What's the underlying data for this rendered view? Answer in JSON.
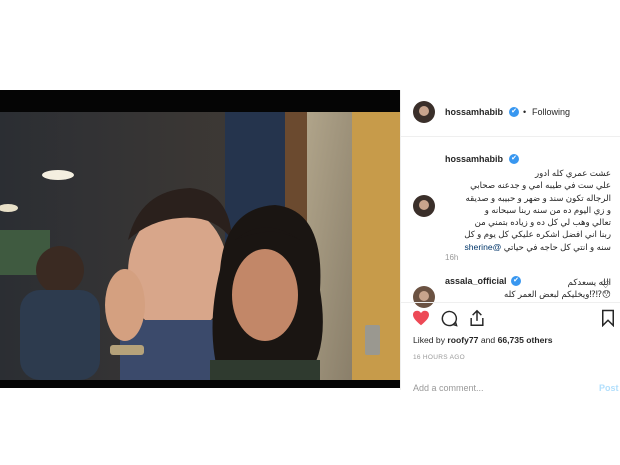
{
  "post": {
    "username": "hossamhabib",
    "verified_mark": "✔",
    "separator": "•",
    "follow_status": "Following",
    "caption_user": "hossamhabib",
    "caption_lines": [
      "عشت عمري كله ادور",
      "علي ست في طيبه امي و جدعنه صحابي",
      "الرجاله تكون سند و ضهر و حبيبه و صديقه",
      "و زي اليوم ده من سنه ربنا سبحانه و",
      "تعالي وهب لي كل ده و زياده بتمني من",
      "ربنا اني افضل اشكره عليكي كل يوم و كل"
    ],
    "caption_last": "سنه و انتي كل حاجه في حياتي",
    "mention": "@sherine",
    "caption_age": "16h",
    "comment_user": "assala_official",
    "comment_line1": "الله يسعدكم",
    "comment_line2": "😯⁉⁉ويخليكم لبعض العمر كله",
    "likes_prefix": "Liked by",
    "likes_user": "roofy77",
    "likes_and": "and",
    "likes_count": "66,735 others",
    "time_ago": "16 HOURS AGO",
    "add_comment": "Add a comment...",
    "post_button": "Post"
  },
  "colors": {
    "accent": "#3897f0",
    "liked": "#ed4956",
    "mention": "#003569"
  },
  "icons": [
    "verified-icon",
    "heart-icon",
    "comment-icon",
    "share-icon",
    "bookmark-icon",
    "avatar-icon"
  ]
}
